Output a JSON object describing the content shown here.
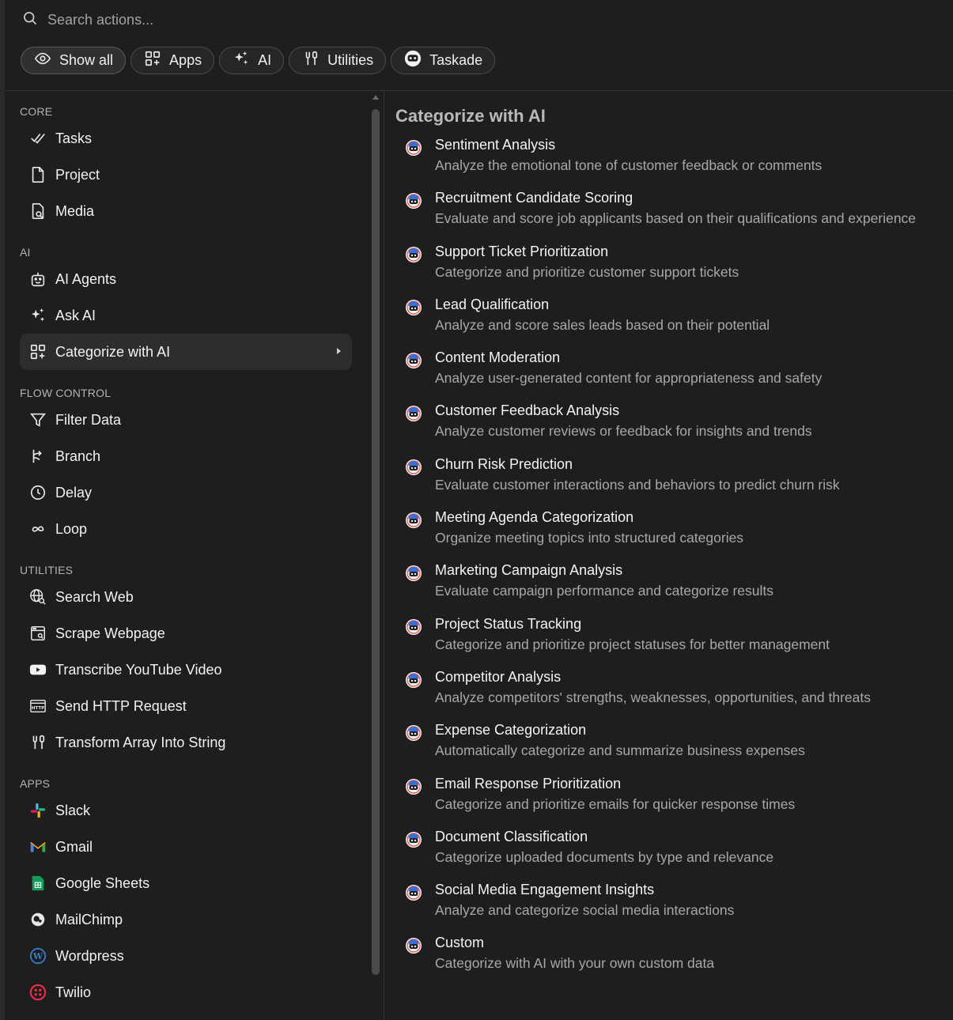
{
  "search": {
    "placeholder": "Search actions..."
  },
  "filters": [
    {
      "label": "Show all",
      "icon": "eye-icon"
    },
    {
      "label": "Apps",
      "icon": "grid-icon"
    },
    {
      "label": "AI",
      "icon": "sparkles-icon"
    },
    {
      "label": "Utilities",
      "icon": "tools-icon"
    },
    {
      "label": "Taskade",
      "icon": "taskade-logo-icon"
    }
  ],
  "sidebar": {
    "sections": [
      {
        "title": "CORE",
        "items": [
          {
            "label": "Tasks",
            "icon": "check-icon"
          },
          {
            "label": "Project",
            "icon": "file-icon"
          },
          {
            "label": "Media",
            "icon": "media-file-icon"
          }
        ]
      },
      {
        "title": "AI",
        "items": [
          {
            "label": "AI Agents",
            "icon": "robot-icon"
          },
          {
            "label": "Ask AI",
            "icon": "sparkles-icon"
          },
          {
            "label": "Categorize with AI",
            "icon": "grid-plus-icon",
            "selected": true
          }
        ]
      },
      {
        "title": "FLOW CONTROL",
        "items": [
          {
            "label": "Filter Data",
            "icon": "funnel-icon"
          },
          {
            "label": "Branch",
            "icon": "branch-icon"
          },
          {
            "label": "Delay",
            "icon": "clock-icon"
          },
          {
            "label": "Loop",
            "icon": "infinity-icon"
          }
        ]
      },
      {
        "title": "UTILITIES",
        "items": [
          {
            "label": "Search Web",
            "icon": "globe-search-icon"
          },
          {
            "label": "Scrape Webpage",
            "icon": "browser-icon"
          },
          {
            "label": "Transcribe YouTube Video",
            "icon": "youtube-icon"
          },
          {
            "label": "Send HTTP Request",
            "icon": "http-icon"
          },
          {
            "label": "Transform Array Into String",
            "icon": "tools-icon"
          }
        ]
      },
      {
        "title": "APPS",
        "items": [
          {
            "label": "Slack",
            "icon": "slack-icon"
          },
          {
            "label": "Gmail",
            "icon": "gmail-icon"
          },
          {
            "label": "Google Sheets",
            "icon": "google-sheets-icon"
          },
          {
            "label": "MailChimp",
            "icon": "mailchimp-icon"
          },
          {
            "label": "Wordpress",
            "icon": "wordpress-icon"
          },
          {
            "label": "Twilio",
            "icon": "twilio-icon"
          }
        ]
      }
    ]
  },
  "main": {
    "title": "Categorize with AI",
    "options": [
      {
        "title": "Sentiment Analysis",
        "desc": "Analyze the emotional tone of customer feedback or comments"
      },
      {
        "title": "Recruitment Candidate Scoring",
        "desc": "Evaluate and score job applicants based on their qualifications and experience"
      },
      {
        "title": "Support Ticket Prioritization",
        "desc": "Categorize and prioritize customer support tickets"
      },
      {
        "title": "Lead Qualification",
        "desc": "Analyze and score sales leads based on their potential"
      },
      {
        "title": "Content Moderation",
        "desc": "Analyze user-generated content for appropriateness and safety"
      },
      {
        "title": "Customer Feedback Analysis",
        "desc": "Analyze customer reviews or feedback for insights and trends"
      },
      {
        "title": "Churn Risk Prediction",
        "desc": "Evaluate customer interactions and behaviors to predict churn risk"
      },
      {
        "title": "Meeting Agenda Categorization",
        "desc": "Organize meeting topics into structured categories"
      },
      {
        "title": "Marketing Campaign Analysis",
        "desc": "Evaluate campaign performance and categorize results"
      },
      {
        "title": "Project Status Tracking",
        "desc": "Categorize and prioritize project statuses for better management"
      },
      {
        "title": "Competitor Analysis",
        "desc": "Analyze competitors' strengths, weaknesses, opportunities, and threats"
      },
      {
        "title": "Expense Categorization",
        "desc": "Automatically categorize and summarize business expenses"
      },
      {
        "title": "Email Response Prioritization",
        "desc": "Categorize and prioritize emails for quicker response times"
      },
      {
        "title": "Document Classification",
        "desc": "Categorize uploaded documents by type and relevance"
      },
      {
        "title": "Social Media Engagement Insights",
        "desc": "Analyze and categorize social media interactions"
      },
      {
        "title": "Custom",
        "desc": "Categorize with AI with your own custom data"
      }
    ]
  }
}
